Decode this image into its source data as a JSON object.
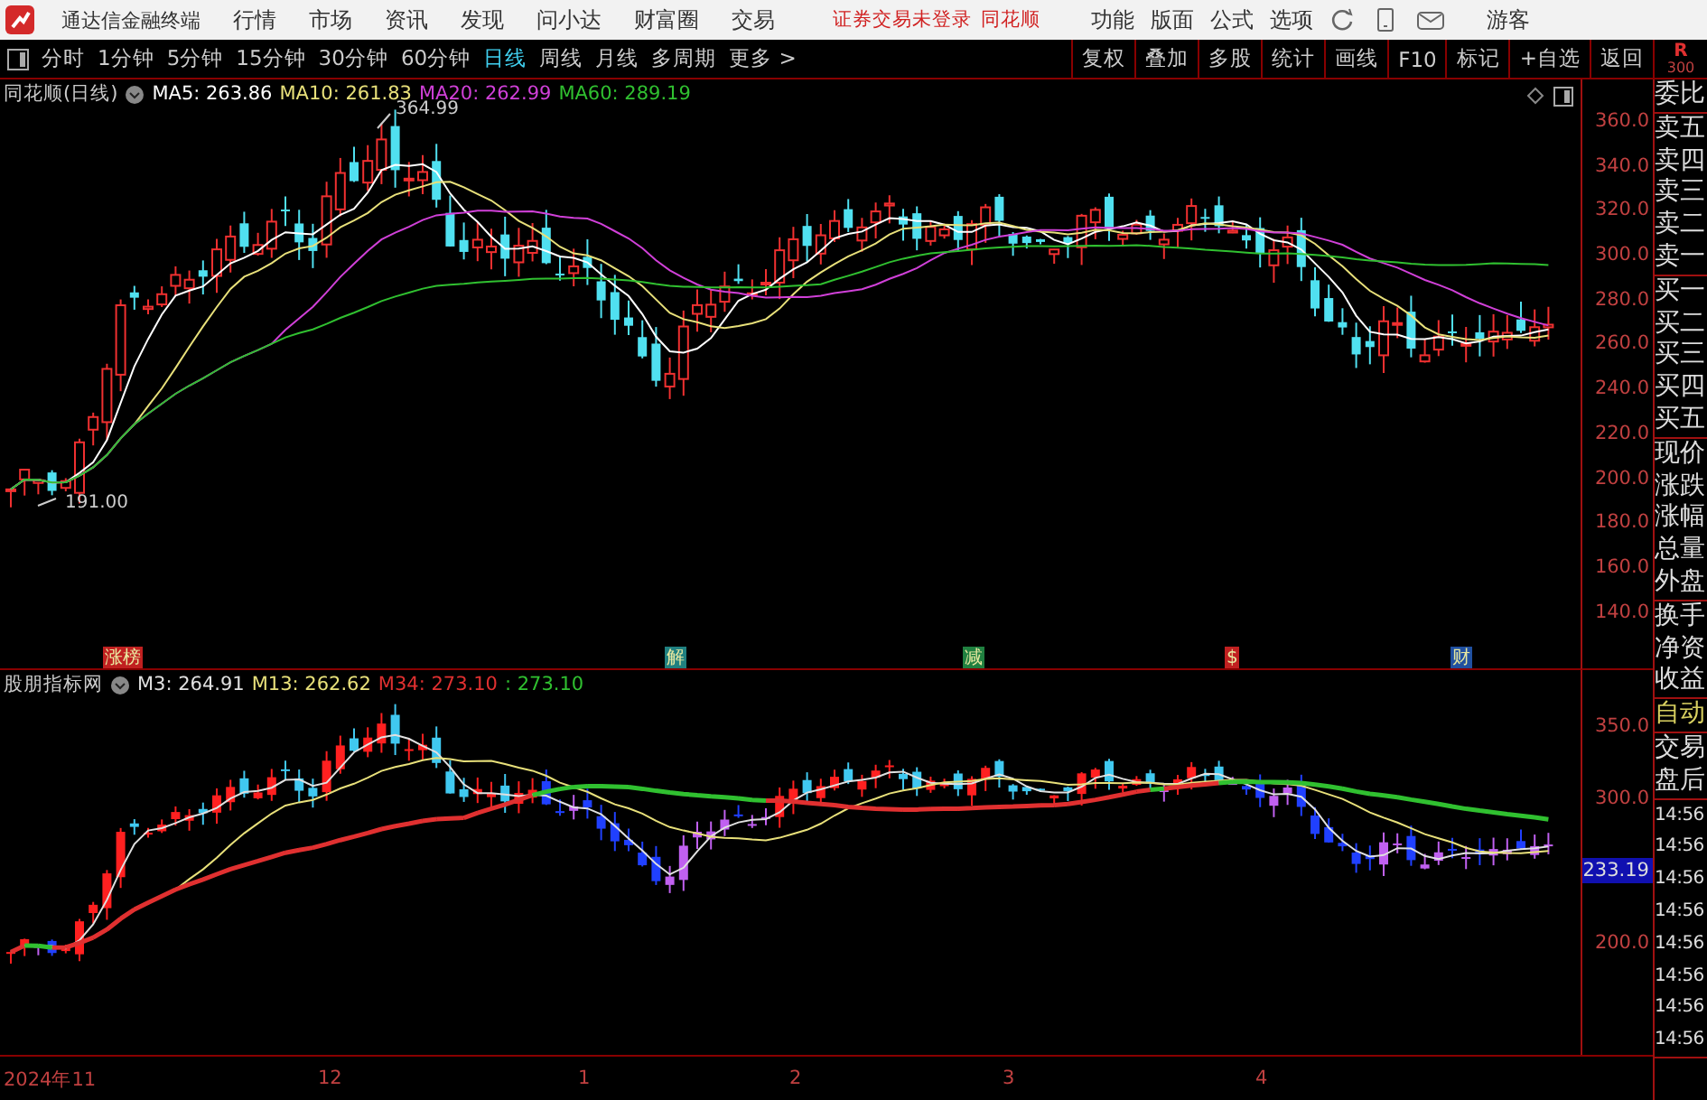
{
  "menu_bar": {
    "app_title": "通达信金融终端",
    "items": [
      "行情",
      "市场",
      "资讯",
      "发现",
      "问小达",
      "财富圈",
      "交易"
    ],
    "notice": "证券交易未登录",
    "notice_link": "同花顺",
    "tools": [
      "功能",
      "版面",
      "公式",
      "选项"
    ],
    "user": "游客"
  },
  "toolbar": {
    "periods": [
      {
        "label": "分时",
        "selected": false
      },
      {
        "label": "1分钟",
        "selected": false
      },
      {
        "label": "5分钟",
        "selected": false
      },
      {
        "label": "15分钟",
        "selected": false
      },
      {
        "label": "30分钟",
        "selected": false
      },
      {
        "label": "60分钟",
        "selected": false
      },
      {
        "label": "日线",
        "selected": true
      },
      {
        "label": "周线",
        "selected": false
      },
      {
        "label": "月线",
        "selected": false
      },
      {
        "label": "多周期",
        "selected": false
      },
      {
        "label": "更多 >",
        "selected": false
      }
    ],
    "actions": [
      "复权",
      "叠加",
      "多股",
      "统计",
      "画线",
      "F10",
      "标记",
      "+自选",
      "返回"
    ]
  },
  "quote_header": {
    "label": "R",
    "value": "300"
  },
  "price_chart": {
    "title": "同花顺(日线)",
    "indicators": [
      {
        "label": "MA5: 263.86",
        "color": "#ffffff"
      },
      {
        "label": "MA10: 261.83",
        "color": "#e8e07a"
      },
      {
        "label": "MA20: 262.99",
        "color": "#d040d8"
      },
      {
        "label": "MA60: 289.19",
        "color": "#30c030"
      }
    ],
    "high_marker": "364.99",
    "low_marker": "191.00",
    "events": [
      {
        "label": "涨榜",
        "color": "#c02020"
      },
      {
        "label": "解",
        "color": "#208080"
      },
      {
        "label": "减",
        "color": "#208040"
      },
      {
        "label": "$",
        "color": "#c02020"
      },
      {
        "label": "财",
        "color": "#2050a0"
      }
    ],
    "y_labels": [
      "360.0",
      "340.0",
      "320.0",
      "300.0",
      "280.0",
      "260.0",
      "240.0",
      "220.0",
      "200.0",
      "180.0",
      "160.0",
      "140.0"
    ]
  },
  "indicator_chart": {
    "title": "股朋指标网",
    "indicators": [
      {
        "label": "M3: 264.91",
        "color": "#e0e0e0"
      },
      {
        "label": "M13: 262.62",
        "color": "#e8e07a"
      },
      {
        "label": "M34: 273.10",
        "color": "#e03030"
      },
      {
        "label": ": 273.10",
        "color": "#30c030"
      }
    ],
    "y_axis": [
      {
        "kind": "tick",
        "label": "350.0"
      },
      {
        "kind": "tick",
        "label": "300.0"
      },
      {
        "kind": "price_tag",
        "label": "233.19"
      },
      {
        "kind": "tick",
        "label": "200.0"
      }
    ]
  },
  "x_labels": [
    "2024年11",
    "12",
    "1",
    "2",
    "3",
    "4"
  ],
  "side_panel": {
    "groups": [
      {
        "kind": "label",
        "items": [
          "委比"
        ]
      },
      {
        "kind": "label",
        "items": [
          "卖五",
          "卖四",
          "卖三",
          "卖二",
          "卖一"
        ]
      },
      {
        "kind": "label",
        "items": [
          "买一",
          "买二",
          "买三",
          "买四",
          "买五"
        ]
      },
      {
        "kind": "label",
        "items": [
          "现价",
          "涨跌",
          "涨幅",
          "总量",
          "外盘"
        ]
      },
      {
        "kind": "label",
        "items": [
          "换手",
          "净资",
          "收益"
        ]
      },
      {
        "kind": "status",
        "items": [
          "自动"
        ]
      },
      {
        "kind": "label",
        "items": [
          "交易",
          "盘后"
        ]
      },
      {
        "kind": "time",
        "items": [
          "14:56",
          "14:56",
          "14:56",
          "14:56",
          "14:56",
          "14:56",
          "14:56",
          "14:56"
        ]
      }
    ]
  }
}
